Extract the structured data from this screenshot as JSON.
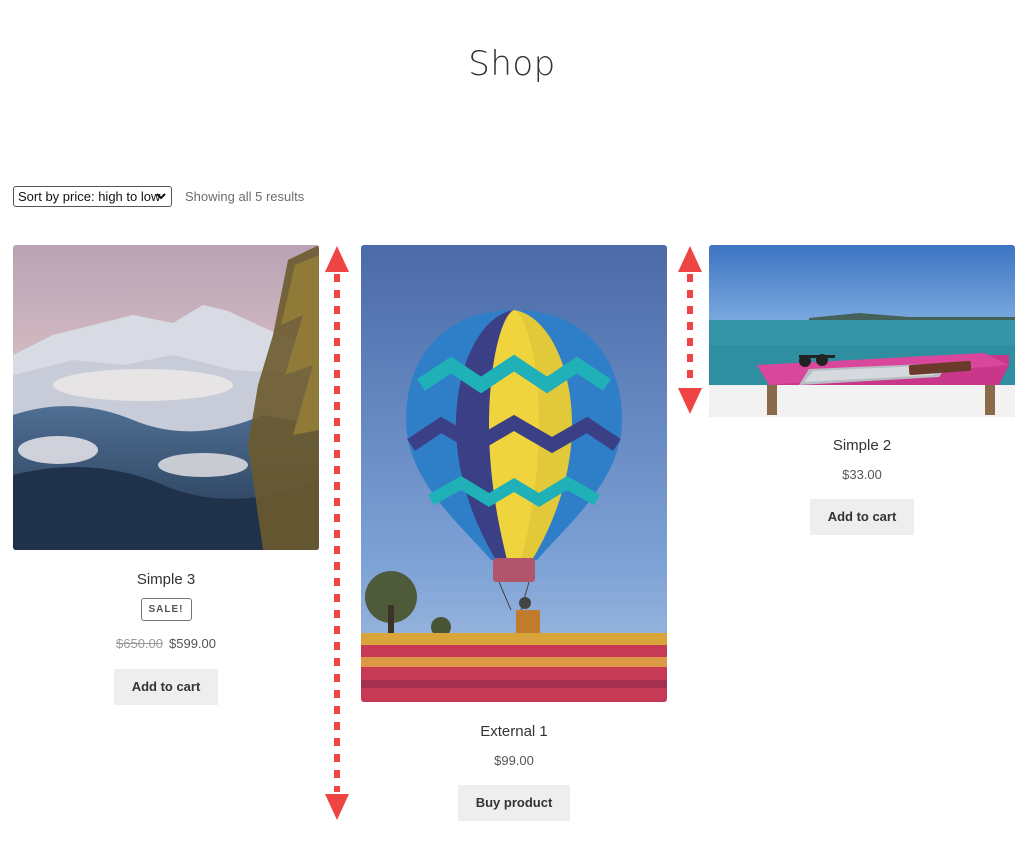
{
  "page": {
    "title": "Shop"
  },
  "toolbar": {
    "sort_selected": "Sort by price: high to low",
    "results_count": "Showing all 5 results"
  },
  "products": [
    {
      "name": "Simple 3",
      "badge": "SALE!",
      "old_price": "$650.00",
      "price": "$599.00",
      "button": "Add to cart",
      "image": "snowy-mountains-photo"
    },
    {
      "name": "External 1",
      "price": "$99.00",
      "button": "Buy product",
      "image": "hot-air-balloon-photo"
    },
    {
      "name": "Simple 2",
      "price": "$33.00",
      "button": "Add to cart",
      "image": "laptop-on-table-by-sea-photo"
    }
  ],
  "annotations": {
    "arrow_color": "#ef4444"
  },
  "colors": {
    "button_bg": "#eeeeee",
    "text": "#43454b"
  }
}
